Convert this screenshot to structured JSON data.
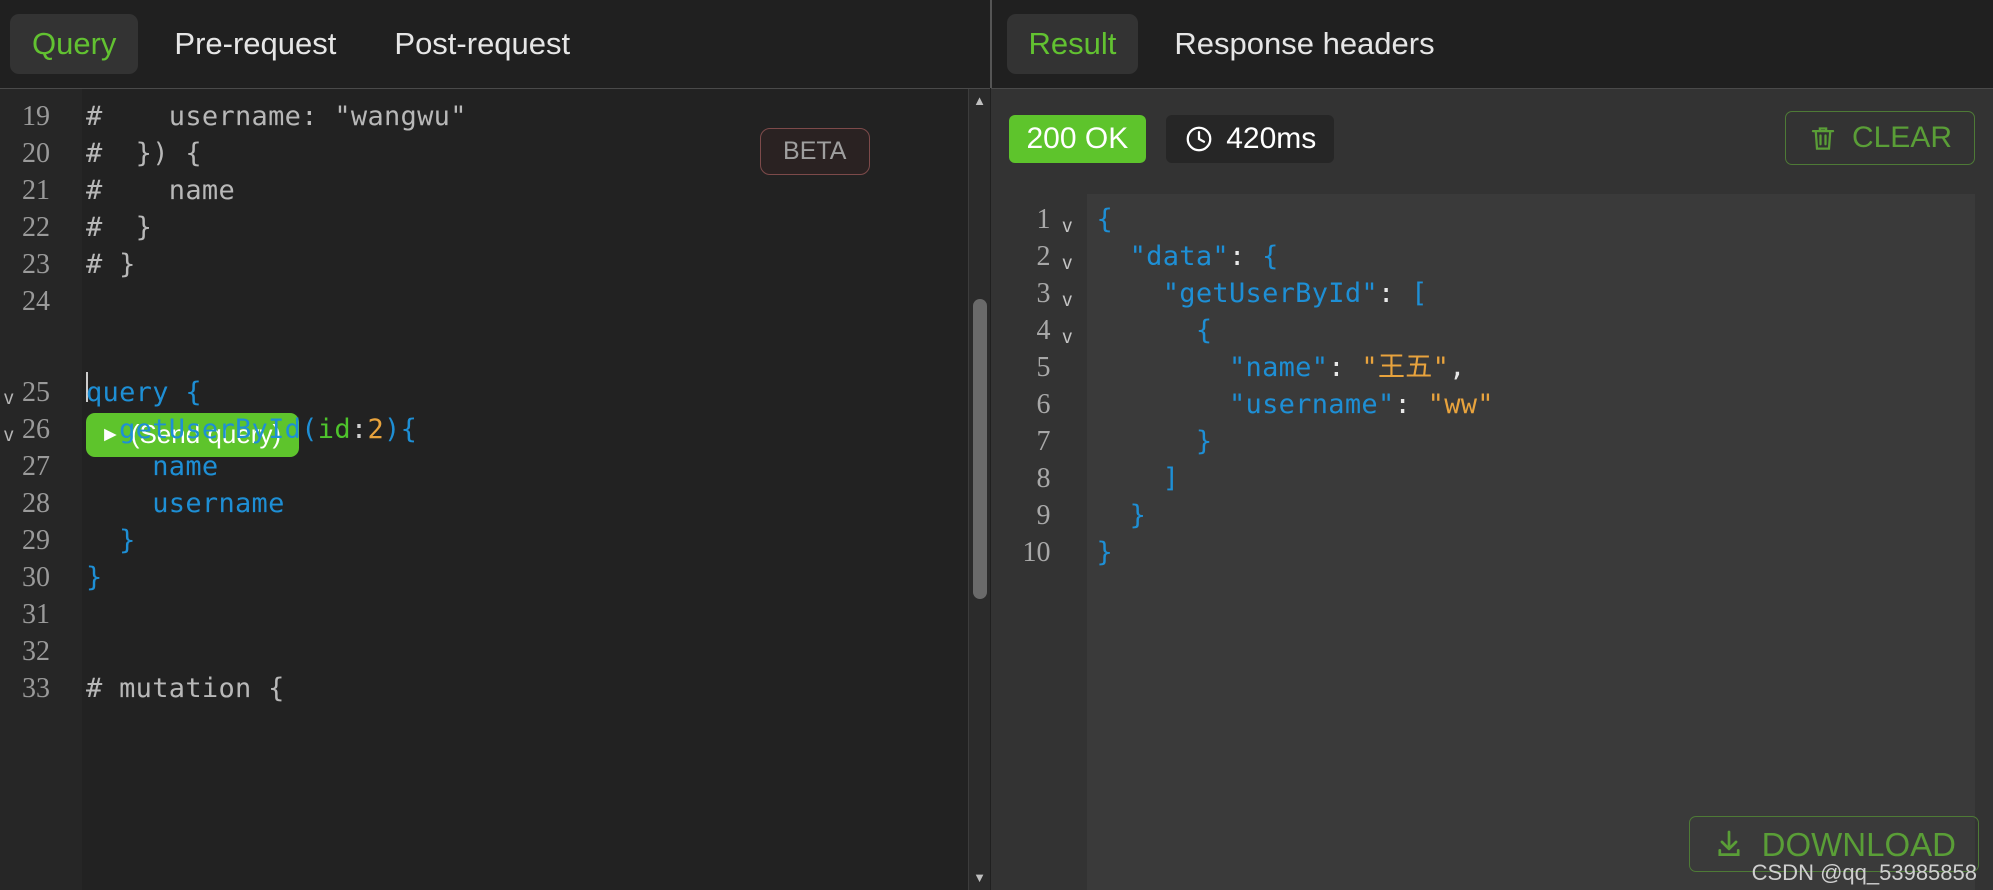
{
  "request_panel": {
    "tabs": [
      {
        "label": "Query",
        "active": true
      },
      {
        "label": "Pre-request",
        "active": false
      },
      {
        "label": "Post-request",
        "active": false
      }
    ],
    "beta_badge": "BETA",
    "send_button": {
      "label": "(Send query)",
      "play_icon": "play-triangle-icon",
      "color": "#5ec42c"
    },
    "editor": {
      "first_visible_line": 19,
      "last_visible_line": 33,
      "cursor_line": 24,
      "lines": [
        {
          "n": "19",
          "fold": "",
          "tokens": [
            {
              "t": "#    username: \"wangwu\"",
              "c": "cmt"
            }
          ]
        },
        {
          "n": "20",
          "fold": "",
          "tokens": [
            {
              "t": "#  }) {",
              "c": "cmt"
            }
          ]
        },
        {
          "n": "21",
          "fold": "",
          "tokens": [
            {
              "t": "#    name",
              "c": "cmt"
            }
          ]
        },
        {
          "n": "22",
          "fold": "",
          "tokens": [
            {
              "t": "#  }",
              "c": "cmt"
            }
          ]
        },
        {
          "n": "23",
          "fold": "",
          "tokens": [
            {
              "t": "# }",
              "c": "cmt"
            }
          ]
        },
        {
          "n": "24",
          "fold": "",
          "tokens": []
        },
        {
          "n": "25",
          "fold": "v",
          "tokens": [
            {
              "t": "query {",
              "c": "kw"
            }
          ]
        },
        {
          "n": "26",
          "fold": "v",
          "tokens": [
            {
              "t": "  getUserById(",
              "c": "fld"
            },
            {
              "t": "id",
              "c": "arg"
            },
            {
              "t": ":",
              "c": "pl"
            },
            {
              "t": "2",
              "c": "num"
            },
            {
              "t": "){",
              "c": "fld"
            }
          ]
        },
        {
          "n": "27",
          "fold": "",
          "tokens": [
            {
              "t": "    name",
              "c": "fld"
            }
          ]
        },
        {
          "n": "28",
          "fold": "",
          "tokens": [
            {
              "t": "    username",
              "c": "fld"
            }
          ]
        },
        {
          "n": "29",
          "fold": "",
          "tokens": [
            {
              "t": "  }",
              "c": "fld"
            }
          ]
        },
        {
          "n": "30",
          "fold": "",
          "tokens": [
            {
              "t": "}",
              "c": "fld"
            }
          ]
        },
        {
          "n": "31",
          "fold": "",
          "tokens": []
        },
        {
          "n": "32",
          "fold": "",
          "tokens": []
        },
        {
          "n": "33",
          "fold": "",
          "tokens": [
            {
              "t": "# mutation {",
              "c": "cmt"
            }
          ]
        }
      ]
    },
    "scrollbar": {
      "up_arrow": "scroll-up-arrow-icon",
      "down_arrow": "scroll-down-arrow-icon"
    }
  },
  "response_panel": {
    "tabs": [
      {
        "label": "Result",
        "active": true
      },
      {
        "label": "Response headers",
        "active": false
      }
    ],
    "status": {
      "code_label": "200 OK",
      "code_color": "#5ec42c",
      "time_label": "420ms",
      "time_icon": "clock-icon"
    },
    "clear_button": {
      "label": "CLEAR",
      "icon": "trash-icon",
      "color": "#5a9e37"
    },
    "download_button": {
      "label": "DOWNLOAD",
      "icon": "download-arrow-icon",
      "color": "#5a9e37"
    },
    "json": {
      "lines": [
        {
          "n": "1",
          "fold": "v",
          "tokens": [
            {
              "t": "{",
              "c": "jpun"
            }
          ]
        },
        {
          "n": "2",
          "fold": "v",
          "tokens": [
            {
              "t": "  ",
              "c": "jpun"
            },
            {
              "t": "\"data\"",
              "c": "jkey"
            },
            {
              "t": ":",
              "c": "jcolon"
            },
            {
              "t": " {",
              "c": "jpun"
            }
          ]
        },
        {
          "n": "3",
          "fold": "v",
          "tokens": [
            {
              "t": "    ",
              "c": "jpun"
            },
            {
              "t": "\"getUserById\"",
              "c": "jkey"
            },
            {
              "t": ":",
              "c": "jcolon"
            },
            {
              "t": " [",
              "c": "jpun"
            }
          ]
        },
        {
          "n": "4",
          "fold": "v",
          "tokens": [
            {
              "t": "      {",
              "c": "jpun"
            }
          ]
        },
        {
          "n": "5",
          "fold": "",
          "tokens": [
            {
              "t": "        ",
              "c": "jpun"
            },
            {
              "t": "\"name\"",
              "c": "jkey"
            },
            {
              "t": ":",
              "c": "jcolon"
            },
            {
              "t": " ",
              "c": "jpun"
            },
            {
              "t": "\"王五\"",
              "c": "jstr"
            },
            {
              "t": ",",
              "c": "jcolon"
            }
          ]
        },
        {
          "n": "6",
          "fold": "",
          "tokens": [
            {
              "t": "        ",
              "c": "jpun"
            },
            {
              "t": "\"username\"",
              "c": "jkey"
            },
            {
              "t": ":",
              "c": "jcolon"
            },
            {
              "t": " ",
              "c": "jpun"
            },
            {
              "t": "\"ww\"",
              "c": "jstr"
            }
          ]
        },
        {
          "n": "7",
          "fold": "",
          "tokens": [
            {
              "t": "      }",
              "c": "jpun"
            }
          ]
        },
        {
          "n": "8",
          "fold": "",
          "tokens": [
            {
              "t": "    ]",
              "c": "jpun"
            }
          ]
        },
        {
          "n": "9",
          "fold": "",
          "tokens": [
            {
              "t": "  }",
              "c": "jpun"
            }
          ]
        },
        {
          "n": "10",
          "fold": "",
          "tokens": [
            {
              "t": "}",
              "c": "jpun"
            }
          ]
        }
      ]
    }
  },
  "watermark": "CSDN @qq_53985858"
}
